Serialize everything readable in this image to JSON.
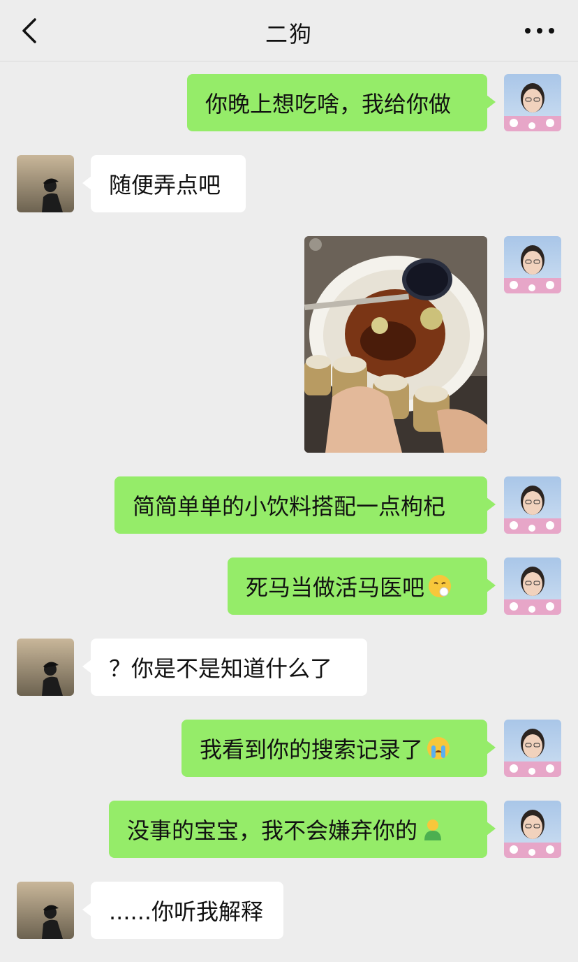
{
  "header": {
    "title": "二狗",
    "back_icon": "chevron-left-icon",
    "more_icon": "more-dots-icon"
  },
  "colors": {
    "background": "#ededed",
    "my_bubble": "#95ec69",
    "other_bubble": "#ffffff"
  },
  "messages": [
    {
      "sender": "me",
      "text": "你晚上想吃啥，我给你做"
    },
    {
      "sender": "other",
      "text": "随便弄点吧"
    },
    {
      "sender": "me",
      "type": "image",
      "image_icon": "drink-photo"
    },
    {
      "sender": "me",
      "text": "简简单单的小饮料搭配一点枸杞"
    },
    {
      "sender": "me",
      "text": "死马当做活马医吧",
      "emoji": "sigh-face-emoji"
    },
    {
      "sender": "other",
      "text": "？你是不是知道什么了"
    },
    {
      "sender": "me",
      "text": "我看到你的搜索记录了",
      "emoji": "crying-face-emoji"
    },
    {
      "sender": "me",
      "text": "没事的宝宝，我不会嫌弃你的",
      "emoji": "green-person-emoji"
    },
    {
      "sender": "other",
      "text": "......你听我解释"
    }
  ]
}
